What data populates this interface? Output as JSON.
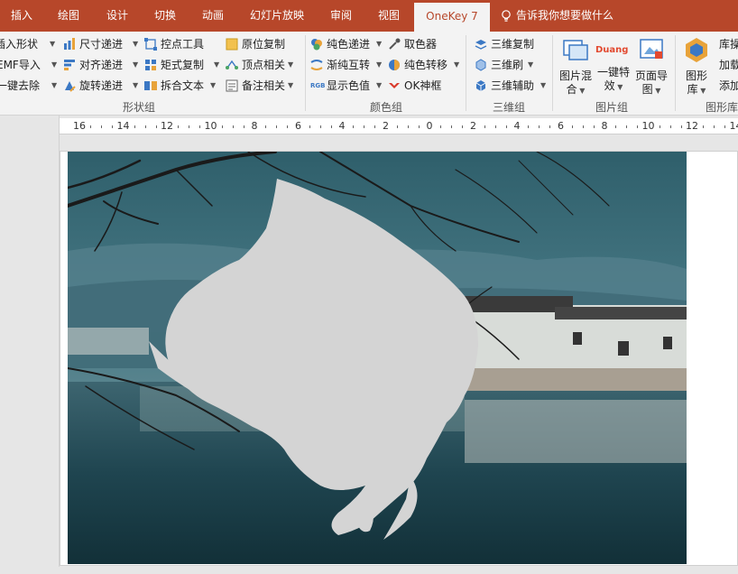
{
  "tabs": [
    {
      "label": "插入",
      "active": false
    },
    {
      "label": "绘图",
      "active": false
    },
    {
      "label": "设计",
      "active": false
    },
    {
      "label": "切换",
      "active": false
    },
    {
      "label": "动画",
      "active": false
    },
    {
      "label": "幻灯片放映",
      "active": false
    },
    {
      "label": "审阅",
      "active": false
    },
    {
      "label": "视图",
      "active": false
    },
    {
      "label": "OneKey 7",
      "active": true
    }
  ],
  "tell_me": "告诉我你想要做什么",
  "ribbon": {
    "shape_group": {
      "label": "形状组",
      "items": [
        {
          "label": "插入形状"
        },
        {
          "label": "EMF导入"
        },
        {
          "label": "一键去除"
        },
        {
          "label": "尺寸递进"
        },
        {
          "label": "对齐递进"
        },
        {
          "label": "旋转递进"
        },
        {
          "label": "控点工具"
        },
        {
          "label": "矩式复制"
        },
        {
          "label": "拆合文本"
        },
        {
          "label": "原位复制"
        },
        {
          "label": "顶点相关"
        },
        {
          "label": "备注相关"
        }
      ]
    },
    "color_group": {
      "label": "颜色组",
      "items": [
        {
          "label": "纯色递进"
        },
        {
          "label": "渐纯互转"
        },
        {
          "label": "显示色值"
        },
        {
          "label": "取色器"
        },
        {
          "label": "纯色转移"
        },
        {
          "label": "OK神框"
        }
      ],
      "rgb_icon": "RGB"
    },
    "three_d_group": {
      "label": "三维组",
      "items": [
        {
          "label": "三维复制"
        },
        {
          "label": "三维刷"
        },
        {
          "label": "三维辅助"
        }
      ]
    },
    "picture_group": {
      "label": "图片组",
      "buttons": [
        {
          "line1": "图片混",
          "line2": "合"
        },
        {
          "line1": "一键特",
          "line2": "效",
          "badge": "Duang"
        },
        {
          "line1": "页面导",
          "line2": "图"
        }
      ]
    },
    "shape_library_group": {
      "label": "图形库",
      "button": {
        "line1": "图形",
        "line2": "库"
      },
      "extra": [
        "库操",
        "加载",
        "添加"
      ]
    }
  },
  "ruler": {
    "labels": [
      "16",
      "14",
      "12",
      "10",
      "8",
      "6",
      "4",
      "2",
      "0",
      "2",
      "4",
      "6",
      "8",
      "10",
      "12",
      "14"
    ]
  }
}
